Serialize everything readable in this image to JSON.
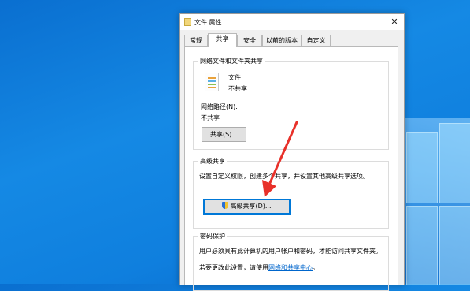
{
  "window": {
    "title": "文件 属性",
    "close_glyph": "✕"
  },
  "tabs": [
    {
      "label": "常规",
      "active": false
    },
    {
      "label": "共享",
      "active": true
    },
    {
      "label": "安全",
      "active": false
    },
    {
      "label": "以前的版本",
      "active": false
    },
    {
      "label": "自定义",
      "active": false
    }
  ],
  "network_sharing": {
    "group_title": "网络文件和文件夹共享",
    "file_name": "文件",
    "file_status": "不共享",
    "path_label": "网络路径(N):",
    "path_value": "不共享",
    "share_button": "共享(S)..."
  },
  "advanced_sharing": {
    "group_title": "高级共享",
    "description": "设置自定义权限，创建多个共享，并设置其他高级共享选项。",
    "button": "高级共享(D)..."
  },
  "password_protection": {
    "group_title": "密码保护",
    "description": "用户必须具有此计算机的用户帐户和密码，才能访问共享文件夹。",
    "change_prefix": "若要更改此设置，请使用",
    "change_link": "网络和共享中心",
    "change_suffix": "。"
  },
  "colors": {
    "accent": "#0078d7",
    "arrow": "#e8312a",
    "desktop": "#1589e4"
  }
}
